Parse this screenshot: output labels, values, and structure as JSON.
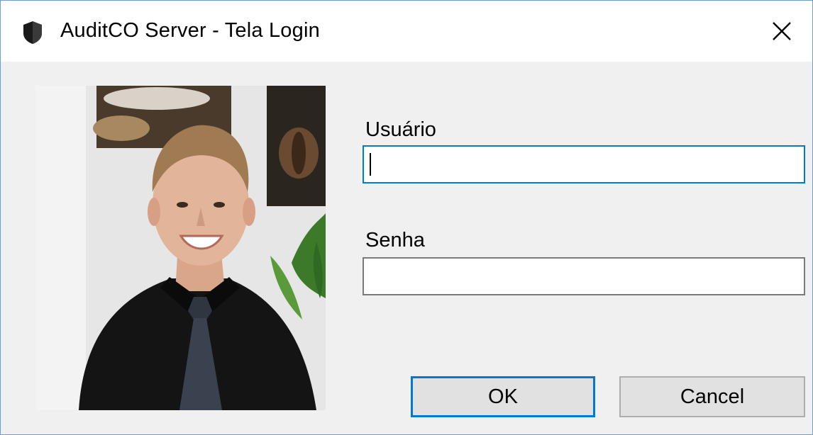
{
  "window": {
    "title": "AuditCO Server - Tela Login",
    "app_icon": "shield-icon",
    "close_icon": "close-icon"
  },
  "form": {
    "username": {
      "label": "Usuário",
      "value": "",
      "placeholder": ""
    },
    "password": {
      "label": "Senha",
      "value": "",
      "placeholder": ""
    }
  },
  "buttons": {
    "ok_label": "OK",
    "cancel_label": "Cancel"
  },
  "colors": {
    "accent": "#0078d7",
    "window_bg": "#f0f0f0",
    "button_bg": "#e1e1e1"
  }
}
